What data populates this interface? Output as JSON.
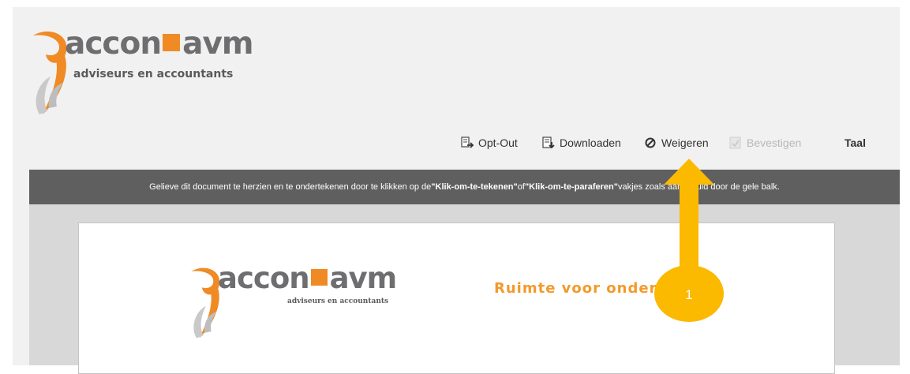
{
  "header": {
    "logo": {
      "name_part1": "accon",
      "name_part2": "avm",
      "tagline": "adviseurs en accountants",
      "accent_color": "#f08a24"
    }
  },
  "toolbar": {
    "opt_out": {
      "label": "Opt-Out",
      "icon": "opt-out-icon"
    },
    "download": {
      "label": "Downloaden",
      "icon": "download-icon"
    },
    "decline": {
      "label": "Weigeren",
      "icon": "decline-icon"
    },
    "confirm": {
      "label": "Bevestigen",
      "icon": "confirm-icon",
      "disabled": true
    },
    "language": {
      "label": "Taal"
    }
  },
  "instruction": {
    "part1": "Gelieve dit document te herzien en te ondertekenen door te klikken op de ",
    "sign_term": "\"Klik-om-te-tekenen\"",
    "part2": " of ",
    "initial_term": "\"Klik-om-te-paraferen\"",
    "part3": " vakjes zoals aangeduid door de gele balk."
  },
  "document": {
    "logo": {
      "name_part1": "accon",
      "name_part2": "avm",
      "tagline": "adviseurs en accountants"
    },
    "slogan": "Ruimte voor ondernemen."
  },
  "annotation": {
    "step_number": "1",
    "color": "#fbb900"
  }
}
